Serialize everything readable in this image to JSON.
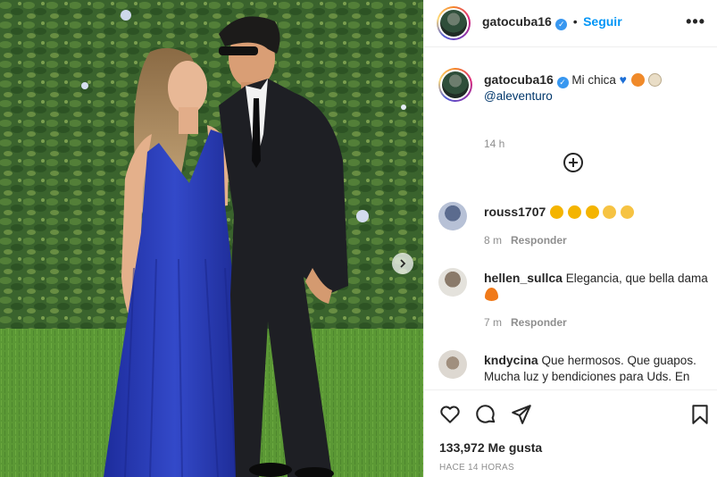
{
  "post": {
    "author": "gatocuba16",
    "verified": true,
    "follow_label": "Seguir",
    "more_icon": "more-options-icon",
    "caption_text": "Mi chica",
    "caption_mention": "@aleventuro",
    "caption_time": "14 h",
    "likes": "133,972 Me gusta",
    "time_ago": "HACE 14 HORAS"
  },
  "comments": [
    {
      "user": "rouss1707",
      "text": "",
      "time": "8 m",
      "reply": "Responder"
    },
    {
      "user": "hellen_sullca",
      "text": "Elegancia, que bella dama",
      "time": "7 m",
      "reply": "Responder"
    },
    {
      "user": "kndycina",
      "text": "Que hermosos. Que guapos. Mucha luz y bendiciones para Uds. En",
      "time": "",
      "reply": ""
    }
  ],
  "colors": {
    "accent": "#0095f6",
    "verified": "#3897f0",
    "text": "#262626",
    "muted": "#8e8e8e",
    "dress": "#2538b8"
  },
  "icons": [
    "heart-icon",
    "comment-icon",
    "share-icon",
    "bookmark-icon",
    "plus-circle-icon",
    "chevron-right-icon"
  ]
}
